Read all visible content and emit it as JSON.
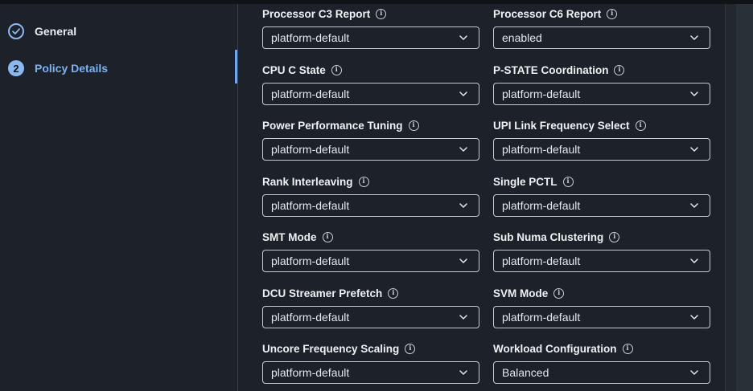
{
  "steps": [
    {
      "label": "General",
      "state": "done",
      "icon": "check-icon"
    },
    {
      "label": "Policy Details",
      "number": "2",
      "state": "active"
    }
  ],
  "fields": [
    {
      "label": "Processor C3 Report",
      "value": "platform-default"
    },
    {
      "label": "Processor C6 Report",
      "value": "enabled"
    },
    {
      "label": "CPU C State",
      "value": "platform-default"
    },
    {
      "label": "P-STATE Coordination",
      "value": "platform-default"
    },
    {
      "label": "Power Performance Tuning",
      "value": "platform-default"
    },
    {
      "label": "UPI Link Frequency Select",
      "value": "platform-default"
    },
    {
      "label": "Rank Interleaving",
      "value": "platform-default"
    },
    {
      "label": "Single PCTL",
      "value": "platform-default"
    },
    {
      "label": "SMT Mode",
      "value": "platform-default"
    },
    {
      "label": "Sub Numa Clustering",
      "value": "platform-default"
    },
    {
      "label": "DCU Streamer Prefetch",
      "value": "platform-default"
    },
    {
      "label": "SVM Mode",
      "value": "platform-default"
    },
    {
      "label": "Uncore Frequency Scaling",
      "value": "platform-default"
    },
    {
      "label": "Workload Configuration",
      "value": "Balanced"
    }
  ],
  "colors": {
    "background": "#1d222a",
    "accent": "#7fb0ef",
    "border": "#c7ccd3",
    "text": "#e9ecf0"
  }
}
